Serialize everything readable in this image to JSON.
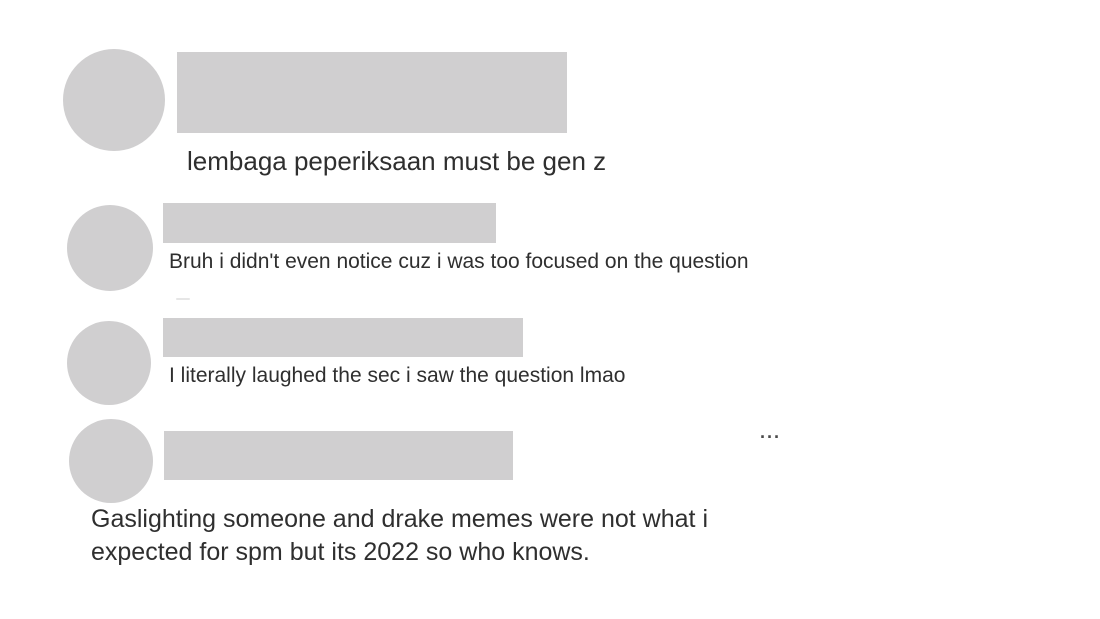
{
  "comments": [
    {
      "text": "lembaga peperiksaan must be gen z",
      "avatar_icon": "user-avatar-redacted",
      "username_redacted": true
    },
    {
      "text": "Bruh i didn't even notice cuz i was too focused on the question",
      "avatar_icon": "user-avatar-redacted",
      "username_redacted": true
    },
    {
      "text": "I literally laughed the sec i saw the question lmao",
      "avatar_icon": "user-avatar-redacted",
      "username_redacted": true
    },
    {
      "text_line1": "Gaslighting someone and drake memes were not what i",
      "text_line2": "expected for spm but its 2022 so who knows.",
      "avatar_icon": "user-avatar-redacted",
      "username_redacted": true,
      "more_label": "···",
      "more_icon": "more-options-icon"
    }
  ],
  "colors": {
    "redaction": "#d0cfd0",
    "text": "#2f2f2f",
    "background": "#ffffff"
  }
}
